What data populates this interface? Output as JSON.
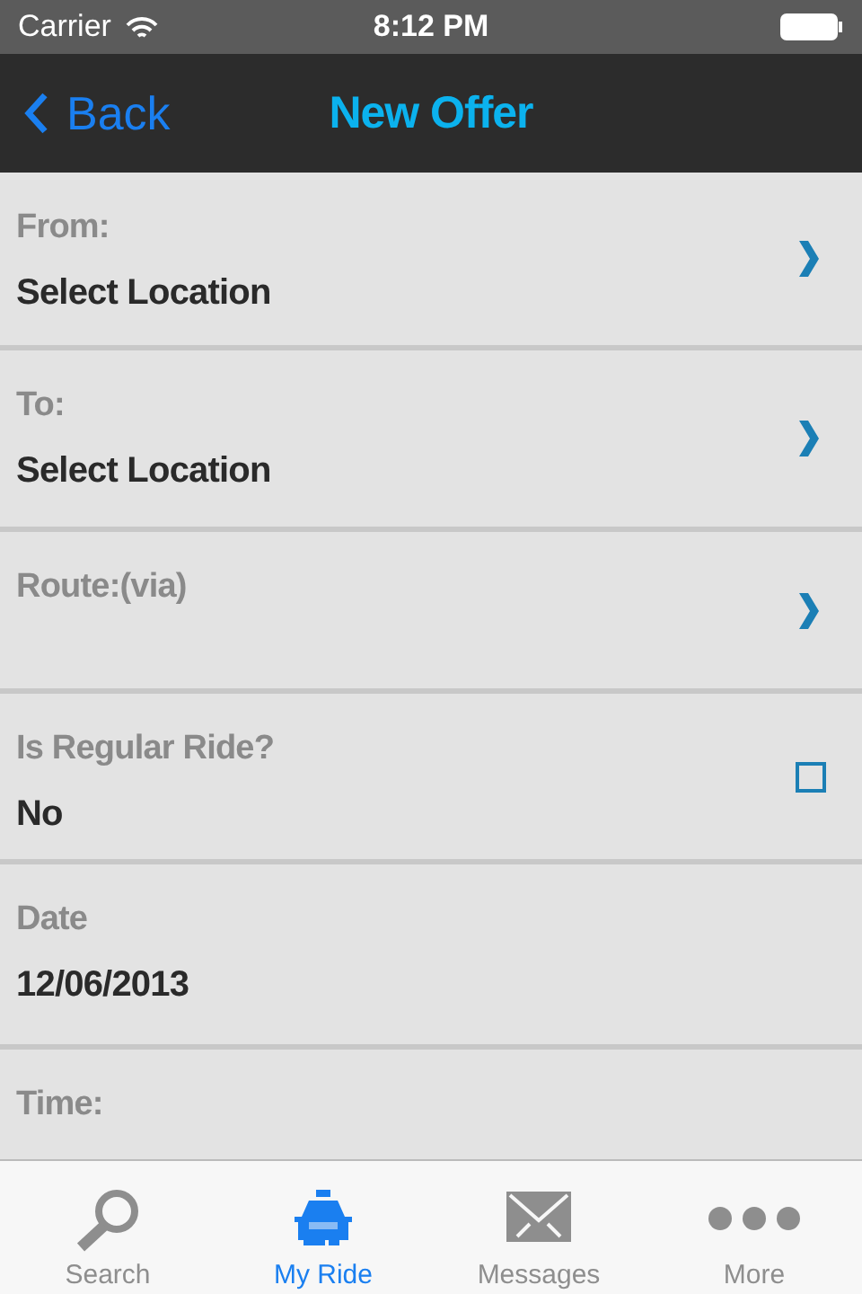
{
  "status_bar": {
    "carrier": "Carrier",
    "time": "8:12 PM"
  },
  "nav_bar": {
    "back": "Back",
    "title": "New Offer"
  },
  "rows": [
    {
      "kind": "link",
      "label": "From:",
      "value": "Select Location"
    },
    {
      "kind": "link",
      "label": "To:",
      "value": "Select Location"
    },
    {
      "kind": "link",
      "label": "Route:(via)"
    },
    {
      "kind": "checkbox",
      "label": "Is Regular Ride?",
      "value": "No",
      "checked": false
    },
    {
      "kind": "plain",
      "label": "Date",
      "value": "12/06/2013"
    },
    {
      "kind": "plain",
      "label": "Time:"
    }
  ],
  "tabs": [
    {
      "kind": "search",
      "label": "Search",
      "selected": false
    },
    {
      "kind": "car",
      "label": "My Ride",
      "selected": true
    },
    {
      "kind": "mail",
      "label": "Messages",
      "selected": false
    },
    {
      "kind": "more",
      "label": "More",
      "selected": false
    }
  ]
}
